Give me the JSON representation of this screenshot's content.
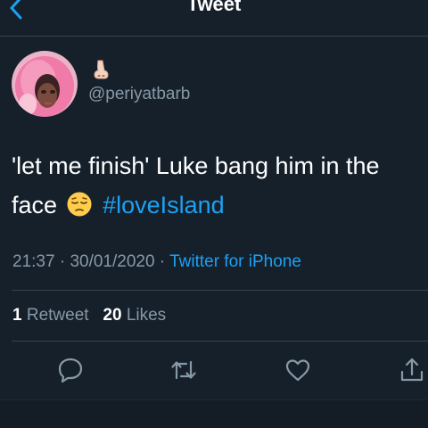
{
  "header": {
    "title": "Tweet",
    "back_icon": "chevron-left-icon"
  },
  "author": {
    "name_emoji": "nose-emoji",
    "handle": "@periyatbarb"
  },
  "tweet": {
    "line1": "'let me finish' Luke bang him in the",
    "line2_text": "face",
    "emoji": "pensive-face-emoji",
    "hashtag": "#loveIsland"
  },
  "meta": {
    "time": "21:37",
    "separator1": " · ",
    "date": "30/01/2020",
    "separator2": " · ",
    "source": "Twitter for iPhone"
  },
  "stats": {
    "retweets_count": "1",
    "retweets_label": "Retweet",
    "likes_count": "20",
    "likes_label": "Likes"
  },
  "actions": [
    {
      "name": "reply",
      "icon": "speech-bubble-icon"
    },
    {
      "name": "retweet",
      "icon": "retweet-arrows-icon"
    },
    {
      "name": "like",
      "icon": "heart-icon"
    },
    {
      "name": "share",
      "icon": "share-upload-icon"
    }
  ],
  "colors": {
    "background": "#15202b",
    "accent": "#1da1f2",
    "muted_text": "#8899a6",
    "divider": "#38444d"
  }
}
